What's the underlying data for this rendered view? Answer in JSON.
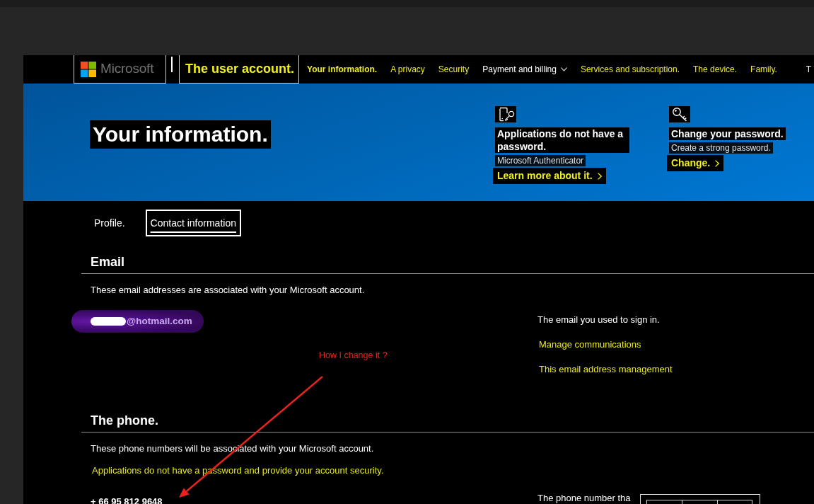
{
  "nav": {
    "logo": "Microsoft",
    "account_title": "The user account.",
    "links": [
      {
        "label": "Your information.",
        "kind": "link",
        "selected": true
      },
      {
        "label": "A privacy",
        "kind": "link",
        "selected": false
      },
      {
        "label": "Security",
        "kind": "link",
        "selected": false
      },
      {
        "label": "Payment and billing",
        "kind": "dropdown",
        "selected": false
      },
      {
        "label": "Services and subscription.",
        "kind": "link",
        "selected": false
      },
      {
        "label": "The device.",
        "kind": "link",
        "selected": false
      },
      {
        "label": "Family.",
        "kind": "link",
        "selected": false
      },
      {
        "label": "T",
        "kind": "menu",
        "selected": false
      }
    ]
  },
  "banner": {
    "title": "Your information.",
    "tiles": [
      {
        "kind": "phone-key",
        "title": "Applications do not have a password.",
        "subtitle": "Microsoft Authenticator",
        "link": "Learn more about it."
      },
      {
        "kind": "key",
        "title": "Change your password.",
        "subtitle": "Create a strong password.",
        "link": "Change."
      }
    ]
  },
  "tabs": [
    {
      "label": "Profile.",
      "selected": false
    },
    {
      "label": "Contact information",
      "selected": true
    }
  ],
  "email_section": {
    "heading": "Email",
    "description": "These email addresses are associated with your Microsoft account.",
    "address": "@hotmail.com",
    "redacted": true,
    "note": "The email you used to sign in.",
    "links": [
      "Manage communications",
      "This email address management"
    ]
  },
  "annotation": {
    "text": "How I change it ?"
  },
  "phone_section": {
    "heading": "The phone.",
    "description": "These phone numbers will be associated with your Microsoft account.",
    "link": "Applications do not have a password and provide your account security.",
    "number": "+ 66 95 812 9648",
    "note": "The phone number tha"
  }
}
